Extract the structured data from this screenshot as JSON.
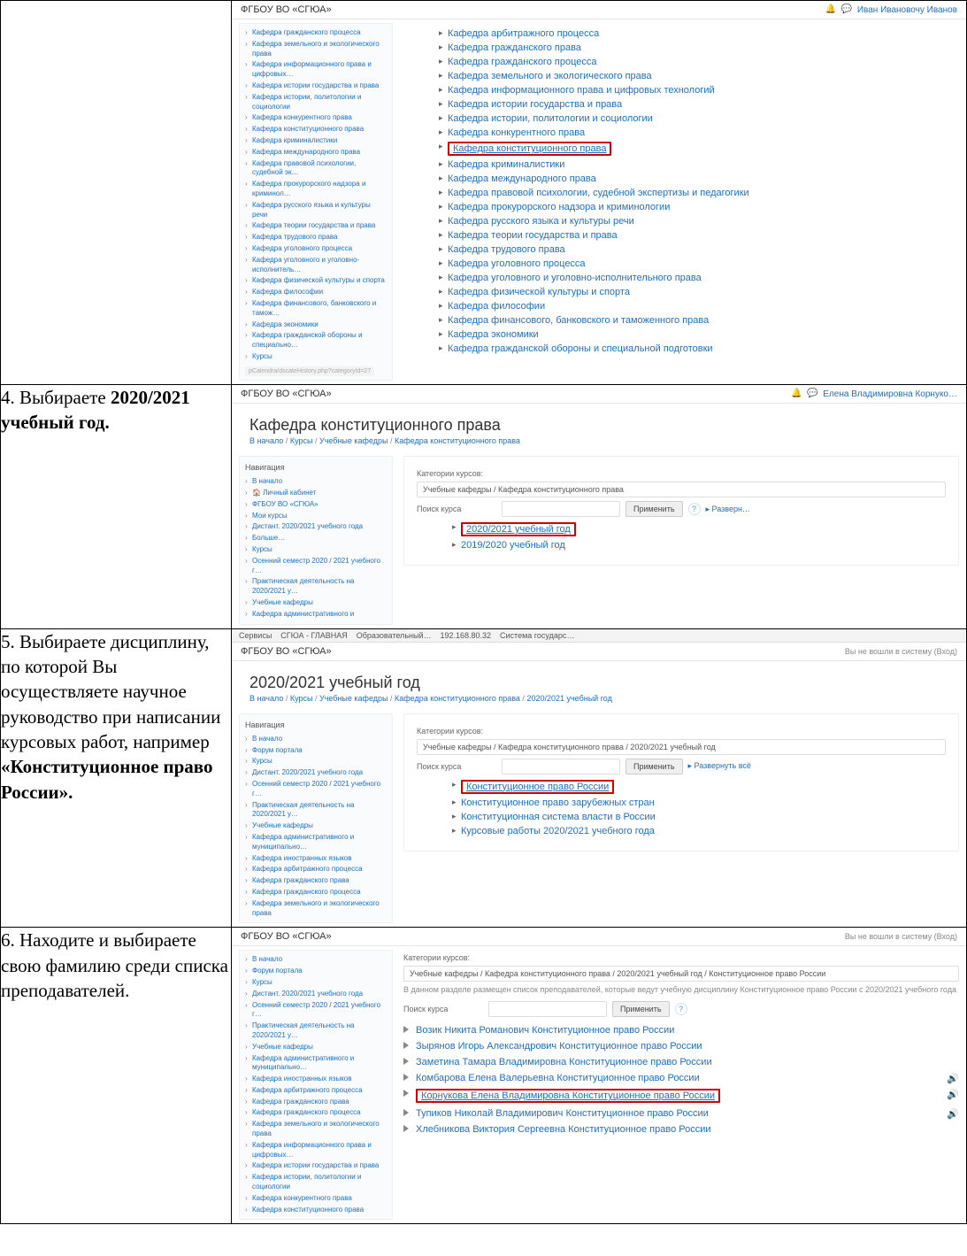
{
  "steps": {
    "s4": {
      "prefix": "4. Выбираете ",
      "bold": "2020/2021 учебный год."
    },
    "s5": {
      "line1": "5. Выбираете дисциплину, по которой Вы осуществляете научное руководство при написании курсовых работ, например ",
      "bold": "«Конституционное право России»."
    },
    "s6": "6. Находите и выбираете свою фамилию среди списка преподавателей."
  },
  "common": {
    "brand": "ФГБОУ ВО «СГЮА»",
    "user1": "Иван Ивановочу Иванов",
    "user2": "Елена Владимировна Корнуко…",
    "login_prompt": "Вы не вошли в систему (Вход)",
    "breadcrumb_sep": " / ",
    "search_label": "Поиск курса",
    "apply": "Применить",
    "cat_label": "Категории курсов:",
    "expand": "▸ Разверн…",
    "expand_all": "▸ Развернуть всё"
  },
  "shot1": {
    "sidebar": [
      "Кафедра гражданского процесса",
      "Кафедра земельного и экологического права",
      "Кафедра информационного права и цифровых…",
      "Кафедра истории государства и права",
      "Кафедра истории, политологии и социологии",
      "Кафедра конкурентного права",
      "Кафедра конституционного права",
      "Кафедра криминалистики",
      "Кафедра международного права",
      "Кафедра правовой психологии, судебной эк…",
      "Кафедра прокурорского надзора и криминол…",
      "Кафедра русского языка и культуры речи",
      "Кафедра теории государства и права",
      "Кафедра трудового права",
      "Кафедра уголовного процесса",
      "Кафедра уголовного и уголовно-исполнитель…",
      "Кафедра физической культуры и спорта",
      "Кафедра философии",
      "Кафедра финансового, банковского и тамож…",
      "Кафедра экономики",
      "Кафедра гражданской обороны и специально…",
      "Курсы"
    ],
    "tinyurl": "pCalendra/dscateHistory.php?categoryId=27",
    "departments": [
      "Кафедра арбитражного процесса",
      "Кафедра гражданского права",
      "Кафедра гражданского процесса",
      "Кафедра земельного и экологического права",
      "Кафедра информационного права и цифровых технологий",
      "Кафедра истории государства и права",
      "Кафедра истории, политологии и социологии",
      "Кафедра конкурентного права",
      "Кафедра конституционного права",
      "Кафедра криминалистики",
      "Кафедра международного права",
      "Кафедра правовой психологии, судебной экспертизы и педагогики",
      "Кафедра прокурорского надзора и криминологии",
      "Кафедра русского языка и культуры речи",
      "Кафедра теории государства и права",
      "Кафедра трудового права",
      "Кафедра уголовного процесса",
      "Кафедра уголовного и уголовно-исполнительного права",
      "Кафедра физической культуры и спорта",
      "Кафедра философии",
      "Кафедра финансового, банковского и таможенного права",
      "Кафедра экономики",
      "Кафедра гражданской обороны и специальной подготовки"
    ],
    "highlight_index": 8
  },
  "shot2": {
    "title": "Кафедра конституционного права",
    "breadcrumb": [
      "В начало",
      "Курсы",
      "Учебные кафедры",
      "Кафедра конституционного права"
    ],
    "nav_title": "Навигация",
    "nav": [
      "В начало",
      "🏠 Личный кабинет",
      "ФГБОУ ВО «СГЮА»",
      "Мои курсы",
      "Дистант. 2020/2021 учебного года",
      "Больше…",
      "Курсы",
      "Осенний семестр 2020 / 2021 учебного г…",
      "Практическая деятельность на 2020/2021 у…",
      "Учебные кафедры",
      "Кафедра административного и"
    ],
    "cat_value": "Учебные кафедры / Кафедра конституционного права",
    "years": [
      "2020/2021 учебный год",
      "2019/2020 учебный год"
    ]
  },
  "shot3": {
    "tabs": [
      "Сервисы",
      "СГЮА - ГЛАВНАЯ",
      "Образовательный…",
      "192.168.80.32",
      "Система государс…"
    ],
    "title": "2020/2021 учебный год",
    "breadcrumb": [
      "В начало",
      "Курсы",
      "Учебные кафедры",
      "Кафедра конституционного права",
      "2020/2021 учебный год"
    ],
    "nav_title": "Навигация",
    "nav": [
      "В начало",
      "Форум портала",
      "Курсы",
      "Дистант. 2020/2021 учебного года",
      "Осенний семестр 2020 / 2021 учебного г…",
      "Практическая деятельность на 2020/2021 у…",
      "Учебные кафедры",
      "Кафедра административного и муниципально…",
      "Кафедра иностранных языков",
      "Кафедра арбитражного процесса",
      "Кафедра гражданского права",
      "Кафедра гражданского процесса",
      "Кафедра земельного и экологического права"
    ],
    "cat_value": "Учебные кафедры / Кафедра конституционного права / 2020/2021 учебный год",
    "courses": [
      "Конституционное право России",
      "Конституционное право зарубежных стран",
      "Конституционная система власти в России",
      "Курсовые работы 2020/2021 учебного года"
    ]
  },
  "shot4": {
    "nav": [
      "В начало",
      "Форум портала",
      "Курсы",
      "Дистант. 2020/2021 учебного года",
      "Осенний семестр 2020 / 2021 учебного г…",
      "Практическая деятельность на 2020/2021 у…",
      "Учебные кафедры",
      "Кафедра административного и муниципально…",
      "Кафедра иностранных языков",
      "Кафедра арбитражного процесса",
      "Кафедра гражданского права",
      "Кафедра гражданского процесса",
      "Кафедра земельного и экологического права",
      "Кафедра информационного права и цифровых…",
      "Кафедра истории государства и права",
      "Кафедра истории, политологии и социологии",
      "Кафедра конкурентного права",
      "Кафедра конституционного права"
    ],
    "cat_value": "Учебные кафедры / Кафедра конституционного права / 2020/2021 учебный год / Конституционное право России",
    "note": "В данном разделе размещен список преподавателей, которые ведут учебную дисциплину Конституционное право России с 2020/2021 учебного года",
    "teachers": [
      "Возик Никита Романович Конституционное право России",
      "Зырянов Игорь Александрович Конституционное право России",
      "Заметина Тамара Владимировна Конституционное право России",
      "Комбарова Елена Валерьевна Конституционное право России",
      "Корнукова Елена Владимировна Конституционное право России",
      "Тупиков Николай Владимирович Конституционное право России",
      "Хлебникова Виктория Сергеевна Конституционное право России"
    ],
    "highlight_index": 4
  }
}
